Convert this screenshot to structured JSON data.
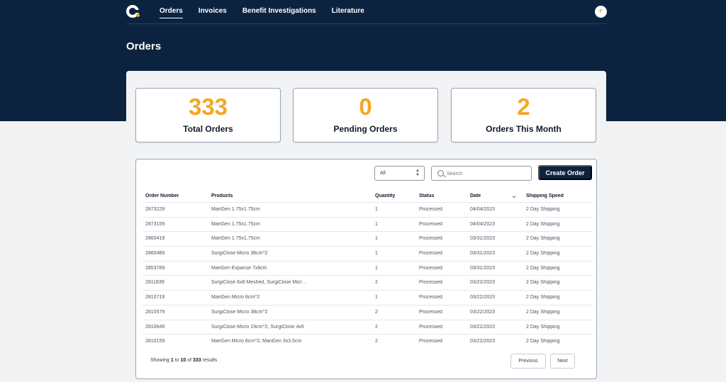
{
  "nav": {
    "items": [
      {
        "label": "Orders",
        "active": true
      },
      {
        "label": "Invoices",
        "active": false
      },
      {
        "label": "Benefit Investigations",
        "active": false
      },
      {
        "label": "Literature",
        "active": false
      }
    ],
    "avatar": "F"
  },
  "page": {
    "title": "Orders"
  },
  "stats": [
    {
      "value": "333",
      "label": "Total Orders"
    },
    {
      "value": "0",
      "label": "Pending Orders"
    },
    {
      "value": "2",
      "label": "Orders This Month"
    }
  ],
  "toolbar": {
    "filter_value": "All",
    "search_placeholder": "Search",
    "search_value": "",
    "create_label": "Create Order"
  },
  "table": {
    "columns": [
      "Order Number",
      "Products",
      "Quantity",
      "Status",
      "Date",
      "Shipping Speed"
    ],
    "rows": [
      [
        "2873229",
        "MariGen 1.75x1.75cm",
        "1",
        "Processed",
        "04/04/2023",
        "2 Day Shipping"
      ],
      [
        "2873159",
        "MariGen 1.75x1.75cm",
        "1",
        "Processed",
        "04/04/2023",
        "2 Day Shipping"
      ],
      [
        "2860419",
        "MariGen 1.75x1.75cm",
        "1",
        "Processed",
        "03/31/2023",
        "2 Day Shipping"
      ],
      [
        "2860489",
        "SurgiClose Micro 38cm^2",
        "1",
        "Processed",
        "03/31/2023",
        "2 Day Shipping"
      ],
      [
        "2853769",
        "MariGen Expanse 7x8cm",
        "1",
        "Processed",
        "03/31/2023",
        "2 Day Shipping"
      ],
      [
        "2811839",
        "SurgiClose 6x8 Meshed, SurgiClose Micr…",
        "2",
        "Processed",
        "03/22/2023",
        "2 Day Shipping"
      ],
      [
        "2810719",
        "MariGen Micro 8cm^2",
        "1",
        "Processed",
        "03/22/2023",
        "2 Day Shipping"
      ],
      [
        "2810579",
        "SurgiClose Micro 38cm^2",
        "2",
        "Processed",
        "03/22/2023",
        "2 Day Shipping"
      ],
      [
        "2810649",
        "SurgiClose Micro 19cm^2, SurgiClose 4x6",
        "2",
        "Processed",
        "03/22/2023",
        "2 Day Shipping"
      ],
      [
        "2810159",
        "MariGen Micro 8cm^2, MariGen 3x3.5cm",
        "2",
        "Processed",
        "03/22/2023",
        "2 Day Shipping"
      ]
    ]
  },
  "pagination": {
    "showing": "Showing",
    "from": "1",
    "to_word": "to",
    "to": "10",
    "of_word": "of",
    "total": "333",
    "results_word": "results",
    "previous": "Previous",
    "next": "Next"
  },
  "colors": {
    "navy": "#0c2340",
    "accent": "#f5a623"
  }
}
